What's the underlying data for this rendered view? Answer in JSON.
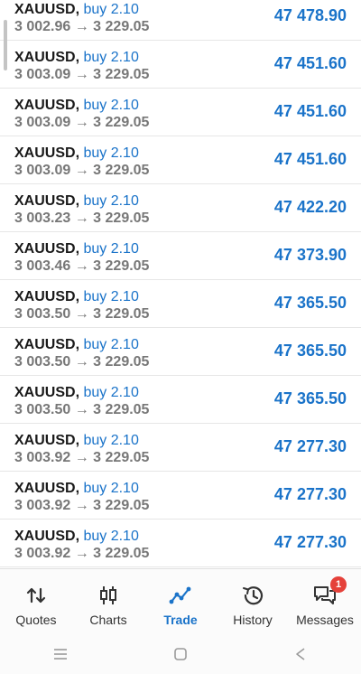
{
  "positions": [
    {
      "symbol": "XAUUSD,",
      "side": "buy 2.10",
      "prices": "3 002.96 → 3 229.05",
      "profit": "47 478.90"
    },
    {
      "symbol": "XAUUSD,",
      "side": "buy 2.10",
      "prices": "3 003.09 → 3 229.05",
      "profit": "47 451.60"
    },
    {
      "symbol": "XAUUSD,",
      "side": "buy 2.10",
      "prices": "3 003.09 → 3 229.05",
      "profit": "47 451.60"
    },
    {
      "symbol": "XAUUSD,",
      "side": "buy 2.10",
      "prices": "3 003.09 → 3 229.05",
      "profit": "47 451.60"
    },
    {
      "symbol": "XAUUSD,",
      "side": "buy 2.10",
      "prices": "3 003.23 → 3 229.05",
      "profit": "47 422.20"
    },
    {
      "symbol": "XAUUSD,",
      "side": "buy 2.10",
      "prices": "3 003.46 → 3 229.05",
      "profit": "47 373.90"
    },
    {
      "symbol": "XAUUSD,",
      "side": "buy 2.10",
      "prices": "3 003.50 → 3 229.05",
      "profit": "47 365.50"
    },
    {
      "symbol": "XAUUSD,",
      "side": "buy 2.10",
      "prices": "3 003.50 → 3 229.05",
      "profit": "47 365.50"
    },
    {
      "symbol": "XAUUSD,",
      "side": "buy 2.10",
      "prices": "3 003.50 → 3 229.05",
      "profit": "47 365.50"
    },
    {
      "symbol": "XAUUSD,",
      "side": "buy 2.10",
      "prices": "3 003.92 → 3 229.05",
      "profit": "47 277.30"
    },
    {
      "symbol": "XAUUSD,",
      "side": "buy 2.10",
      "prices": "3 003.92 → 3 229.05",
      "profit": "47 277.30"
    },
    {
      "symbol": "XAUUSD,",
      "side": "buy 2.10",
      "prices": "3 003.92 → 3 229.05",
      "profit": "47 277.30"
    }
  ],
  "tabs": [
    {
      "label": "Quotes",
      "icon": "quotes-arrows-icon"
    },
    {
      "label": "Charts",
      "icon": "candlestick-icon"
    },
    {
      "label": "Trade",
      "icon": "trade-line-icon",
      "active": true
    },
    {
      "label": "History",
      "icon": "history-clock-icon"
    },
    {
      "label": "Messages",
      "icon": "messages-chat-icon",
      "badge": "1"
    }
  ],
  "colors": {
    "accent": "#1a73c9",
    "badge": "#e5413a",
    "muted": "#777777"
  },
  "system_nav": [
    "menu-icon",
    "home-icon",
    "back-icon"
  ]
}
